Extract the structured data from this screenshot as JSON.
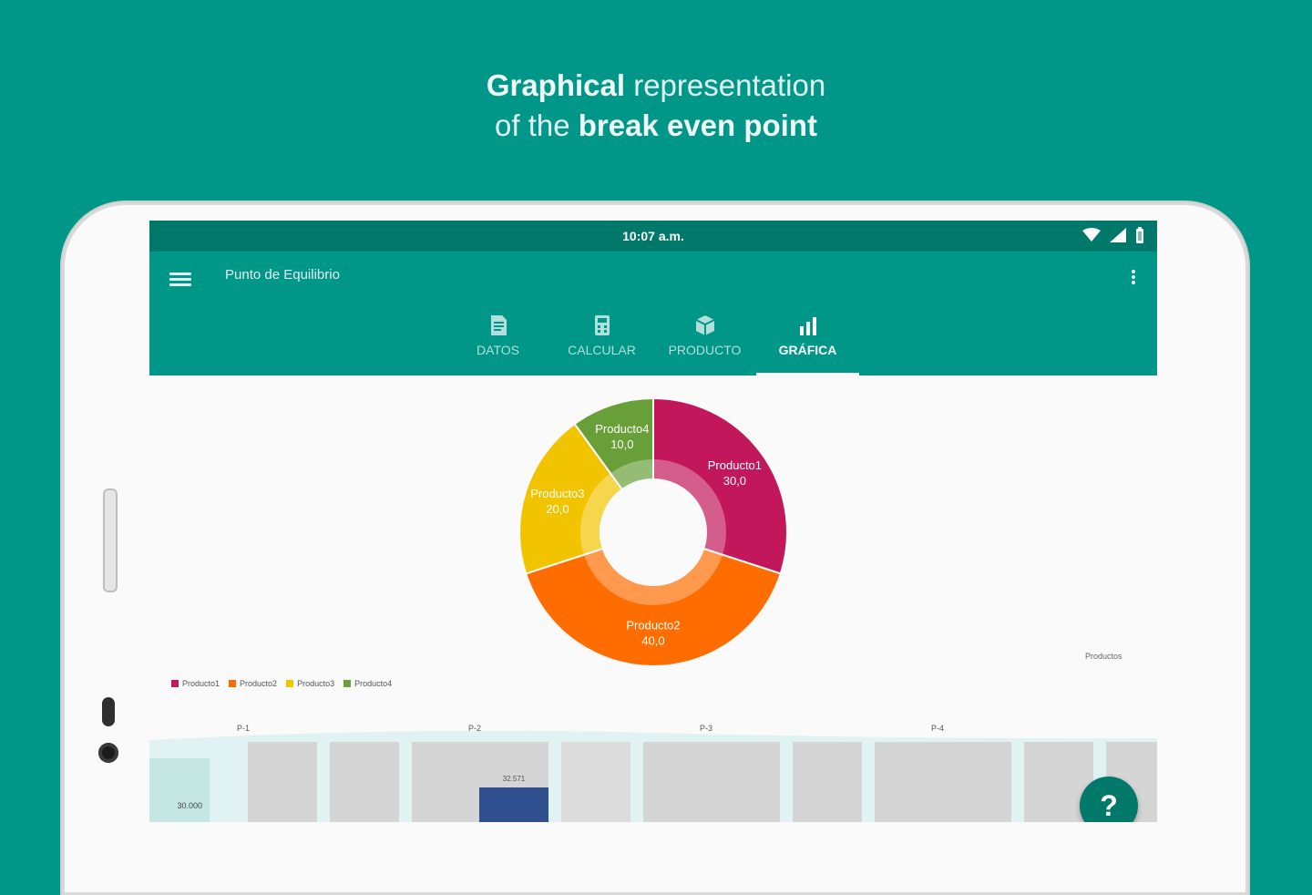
{
  "headline": {
    "line1_bold": "Graphical",
    "line1_rest": " representation",
    "line2_light": "of the ",
    "line2_bold": "break even point"
  },
  "status": {
    "time": "10:07 a.m."
  },
  "appbar": {
    "title": "Punto de Equilibrio"
  },
  "tabs": [
    {
      "label": "DATOS",
      "icon": "document-icon"
    },
    {
      "label": "CALCULAR",
      "icon": "calculator-icon"
    },
    {
      "label": "PRODUCTO",
      "icon": "box-icon"
    },
    {
      "label": "GRÁFICA",
      "icon": "bar-chart-icon",
      "active": true
    }
  ],
  "colors": {
    "p1": "#c2185b",
    "p2": "#ff6d00",
    "p3": "#f2c400",
    "p4": "#689f38",
    "bar_gray": "#d5d5d5",
    "bar_blue": "#2f4f8f"
  },
  "chart_data": [
    {
      "type": "pie",
      "title": "",
      "categories": [
        "Producto1",
        "Producto2",
        "Producto3",
        "Producto4"
      ],
      "values": [
        30.0,
        40.0,
        20.0,
        10.0
      ],
      "value_labels": [
        "30,0",
        "40,0",
        "20,0",
        "10,0"
      ],
      "legend": [
        "Producto1",
        "Producto2",
        "Producto3",
        "Producto4"
      ],
      "legend_title": "Productos",
      "legend_position": "bottom-left"
    },
    {
      "type": "bar",
      "categories": [
        "P-1",
        "P-2",
        "P-3",
        "P-4"
      ],
      "y_tick_label": "30.000",
      "value_label": "32.571",
      "highlight_category": "P-2"
    }
  ],
  "fab": {
    "label": "?"
  }
}
